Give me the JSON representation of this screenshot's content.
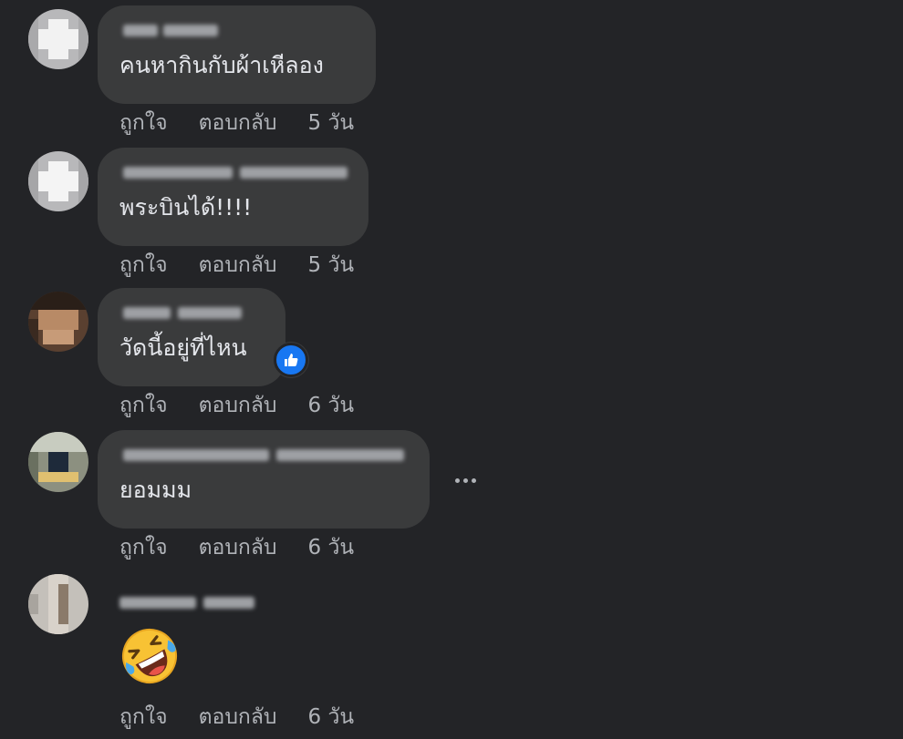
{
  "comments": [
    {
      "text": "คนหากินกับผ้าเหีลอง",
      "like_label": "ถูกใจ",
      "reply_label": "ตอบกลับ",
      "time": "5 วัน"
    },
    {
      "text": "พระบินได้!!!!",
      "like_label": "ถูกใจ",
      "reply_label": "ตอบกลับ",
      "time": "5 วัน"
    },
    {
      "text": "วัดนี้อยู่ที่ไหน",
      "like_label": "ถูกใจ",
      "reply_label": "ตอบกลับ",
      "time": "6 วัน",
      "reaction": "like-icon"
    },
    {
      "text": "ยอมมม",
      "like_label": "ถูกใจ",
      "reply_label": "ตอบกลับ",
      "time": "6 วัน",
      "more": "more-options-icon"
    },
    {
      "sticker": "rolling-on-floor-laughing-emoji",
      "like_label": "ถูกใจ",
      "reply_label": "ตอบกลับ",
      "time": "6 วัน"
    }
  ],
  "colors": {
    "background": "#232427",
    "bubble": "#3a3b3c",
    "text": "#e4e6eb",
    "secondary_text": "#b0b3b8",
    "like_blue": "#1877f2"
  }
}
